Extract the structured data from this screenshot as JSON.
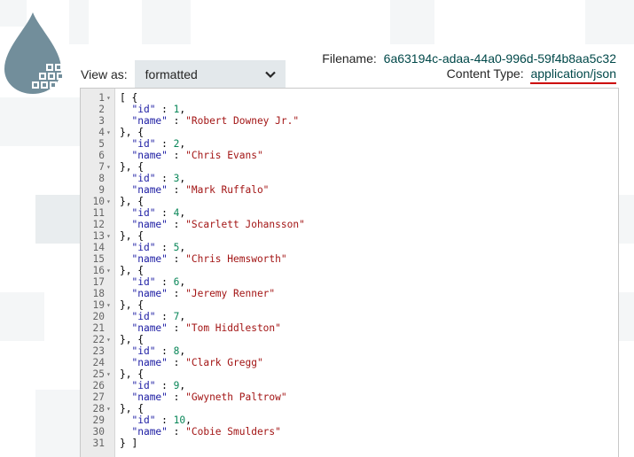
{
  "view_as": {
    "label": "View as:",
    "selected": "formatted"
  },
  "header": {
    "filename_label": "Filename:",
    "filename_value": "6a63194c-adaa-44a0-996d-59f4b8aa5c32",
    "content_type_label": "Content Type:",
    "content_type_value": "application/json"
  },
  "editor": {
    "items": [
      {
        "id": "1",
        "name": "\"Robert Downey Jr.\""
      },
      {
        "id": "2",
        "name": "\"Chris Evans\""
      },
      {
        "id": "3",
        "name": "\"Mark Ruffalo\""
      },
      {
        "id": "4",
        "name": "\"Scarlett Johansson\""
      },
      {
        "id": "5",
        "name": "\"Chris Hemsworth\""
      },
      {
        "id": "6",
        "name": "\"Jeremy Renner\""
      },
      {
        "id": "7",
        "name": "\"Tom Hiddleston\""
      },
      {
        "id": "8",
        "name": "\"Clark Gregg\""
      },
      {
        "id": "9",
        "name": "\"Gwyneth Paltrow\""
      },
      {
        "id": "10",
        "name": "\"Cobie Smulders\""
      }
    ]
  },
  "colors": {
    "accent_underline": "#cc0000",
    "logo": "#728e9b",
    "select_bg": "#e3e8eb"
  },
  "icons": {
    "logo": "droplet-logo-icon",
    "dropdown": "chevron-down-icon",
    "fold": "fold-arrow-icon"
  }
}
